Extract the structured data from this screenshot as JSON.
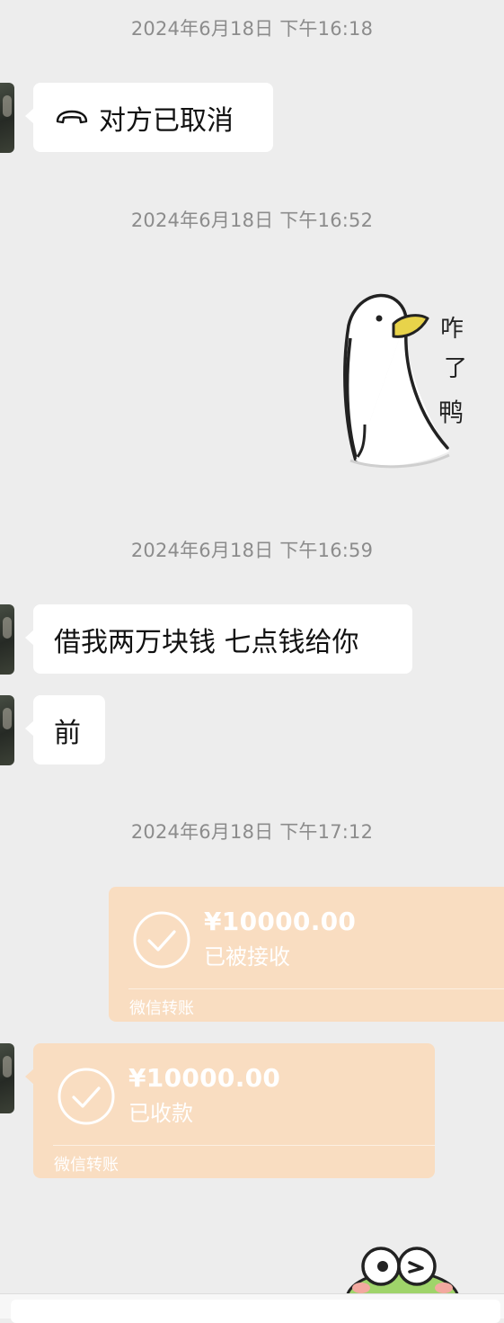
{
  "timestamps": {
    "t1": "2024年6月18日 下午16:18",
    "t2": "2024年6月18日 下午16:52",
    "t3": "2024年6月18日 下午16:59",
    "t4": "2024年6月18日 下午17:12"
  },
  "messages": {
    "call_cancelled": "对方已取消",
    "borrow": "借我两万块钱 七点钱给你",
    "qian": "前"
  },
  "sticker_duck": {
    "text": "咋了鸭",
    "icon": "duck-sticker"
  },
  "transfer_sent": {
    "amount": "¥10000.00",
    "status": "已被接收",
    "label": "微信转账"
  },
  "transfer_received": {
    "amount": "¥10000.00",
    "status": "已收款",
    "label": "微信转账"
  },
  "colors": {
    "background": "#ededed",
    "bubble": "#ffffff",
    "transfer": "#f9ddc1",
    "timestamp": "#8c8c8c"
  }
}
